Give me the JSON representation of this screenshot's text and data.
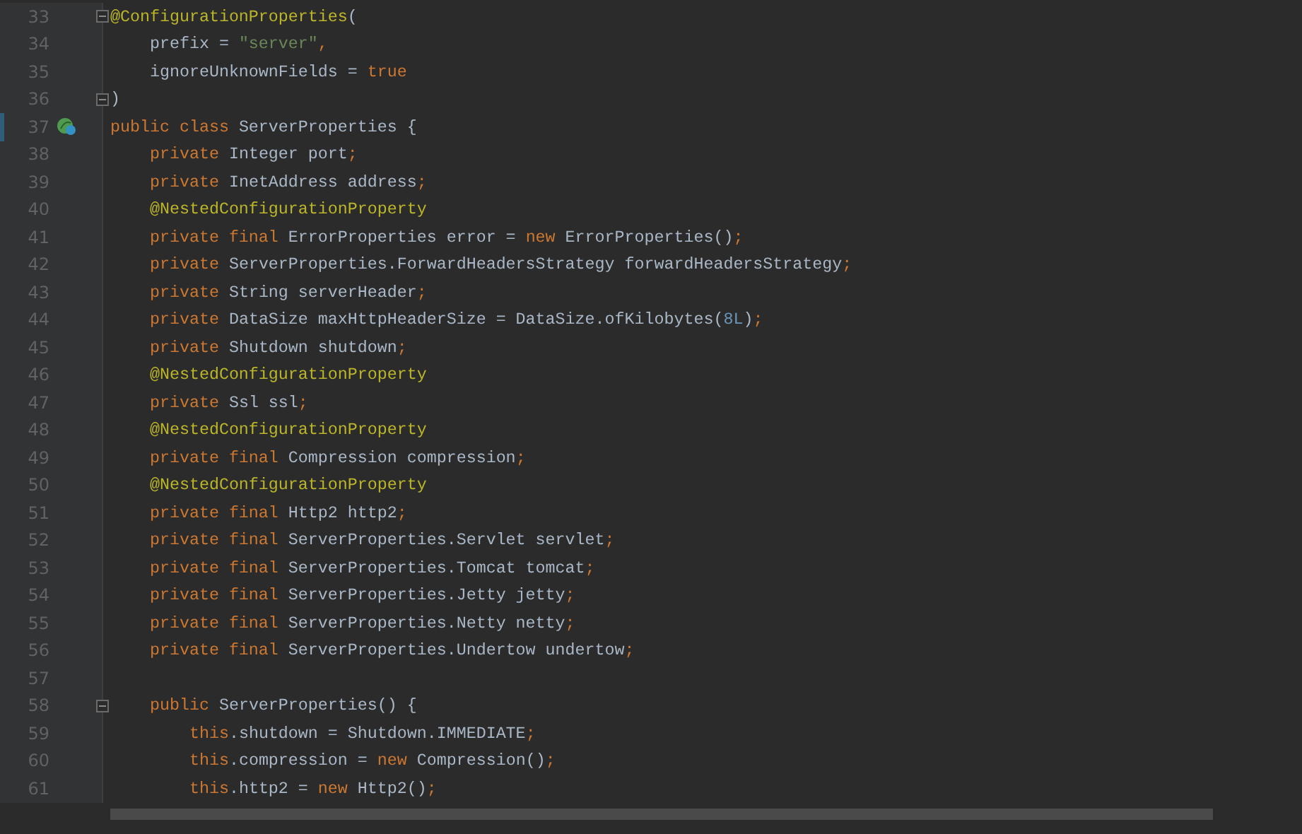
{
  "editor": {
    "lines": [
      {
        "number": "33",
        "fold": true,
        "class_icon": false,
        "changed": false,
        "tokens": [
          {
            "t": "@ConfigurationProperties",
            "color": "#bbb529"
          },
          {
            "t": "(",
            "color": "#a9b7c6"
          }
        ]
      },
      {
        "number": "34",
        "fold": false,
        "class_icon": false,
        "changed": false,
        "tokens": [
          {
            "t": "    prefix = ",
            "color": "#a9b7c6"
          },
          {
            "t": "\"server\"",
            "color": "#6a8759"
          },
          {
            "t": ",",
            "color": "#cc7832"
          }
        ]
      },
      {
        "number": "35",
        "fold": false,
        "class_icon": false,
        "changed": false,
        "tokens": [
          {
            "t": "    ignoreUnknownFields = ",
            "color": "#a9b7c6"
          },
          {
            "t": "true",
            "color": "#cc7832"
          }
        ]
      },
      {
        "number": "36",
        "fold": true,
        "class_icon": false,
        "changed": false,
        "tokens": [
          {
            "t": ")",
            "color": "#a9b7c6"
          }
        ]
      },
      {
        "number": "37",
        "fold": false,
        "class_icon": true,
        "changed": true,
        "tokens": [
          {
            "t": "public class ",
            "color": "#cc7832"
          },
          {
            "t": "ServerProperties {",
            "color": "#a9b7c6"
          }
        ]
      },
      {
        "number": "38",
        "fold": false,
        "class_icon": false,
        "changed": false,
        "tokens": [
          {
            "t": "    private ",
            "color": "#cc7832"
          },
          {
            "t": "Integer port",
            "color": "#a9b7c6"
          },
          {
            "t": ";",
            "color": "#cc7832"
          }
        ]
      },
      {
        "number": "39",
        "fold": false,
        "class_icon": false,
        "changed": false,
        "tokens": [
          {
            "t": "    private ",
            "color": "#cc7832"
          },
          {
            "t": "InetAddress address",
            "color": "#a9b7c6"
          },
          {
            "t": ";",
            "color": "#cc7832"
          }
        ]
      },
      {
        "number": "40",
        "fold": false,
        "class_icon": false,
        "changed": false,
        "tokens": [
          {
            "t": "    @NestedConfigurationProperty",
            "color": "#bbb529"
          }
        ]
      },
      {
        "number": "41",
        "fold": false,
        "class_icon": false,
        "changed": false,
        "tokens": [
          {
            "t": "    private final ",
            "color": "#cc7832"
          },
          {
            "t": "ErrorProperties error = ",
            "color": "#a9b7c6"
          },
          {
            "t": "new ",
            "color": "#cc7832"
          },
          {
            "t": "ErrorProperties()",
            "color": "#a9b7c6"
          },
          {
            "t": ";",
            "color": "#cc7832"
          }
        ]
      },
      {
        "number": "42",
        "fold": false,
        "class_icon": false,
        "changed": false,
        "tokens": [
          {
            "t": "    private ",
            "color": "#cc7832"
          },
          {
            "t": "ServerProperties.ForwardHeadersStrategy forwardHeadersStrategy",
            "color": "#a9b7c6"
          },
          {
            "t": ";",
            "color": "#cc7832"
          }
        ]
      },
      {
        "number": "43",
        "fold": false,
        "class_icon": false,
        "changed": false,
        "tokens": [
          {
            "t": "    private ",
            "color": "#cc7832"
          },
          {
            "t": "String serverHeader",
            "color": "#a9b7c6"
          },
          {
            "t": ";",
            "color": "#cc7832"
          }
        ]
      },
      {
        "number": "44",
        "fold": false,
        "class_icon": false,
        "changed": false,
        "tokens": [
          {
            "t": "    private ",
            "color": "#cc7832"
          },
          {
            "t": "DataSize maxHttpHeaderSize = DataSize.ofKilobytes(",
            "color": "#a9b7c6"
          },
          {
            "t": "8L",
            "color": "#6897bb"
          },
          {
            "t": ")",
            "color": "#a9b7c6"
          },
          {
            "t": ";",
            "color": "#cc7832"
          }
        ]
      },
      {
        "number": "45",
        "fold": false,
        "class_icon": false,
        "changed": false,
        "tokens": [
          {
            "t": "    private ",
            "color": "#cc7832"
          },
          {
            "t": "Shutdown shutdown",
            "color": "#a9b7c6"
          },
          {
            "t": ";",
            "color": "#cc7832"
          }
        ]
      },
      {
        "number": "46",
        "fold": false,
        "class_icon": false,
        "changed": false,
        "tokens": [
          {
            "t": "    @NestedConfigurationProperty",
            "color": "#bbb529"
          }
        ]
      },
      {
        "number": "47",
        "fold": false,
        "class_icon": false,
        "changed": false,
        "tokens": [
          {
            "t": "    private ",
            "color": "#cc7832"
          },
          {
            "t": "Ssl ssl",
            "color": "#a9b7c6"
          },
          {
            "t": ";",
            "color": "#cc7832"
          }
        ]
      },
      {
        "number": "48",
        "fold": false,
        "class_icon": false,
        "changed": false,
        "tokens": [
          {
            "t": "    @NestedConfigurationProperty",
            "color": "#bbb529"
          }
        ]
      },
      {
        "number": "49",
        "fold": false,
        "class_icon": false,
        "changed": false,
        "tokens": [
          {
            "t": "    private final ",
            "color": "#cc7832"
          },
          {
            "t": "Compression compression",
            "color": "#a9b7c6"
          },
          {
            "t": ";",
            "color": "#cc7832"
          }
        ]
      },
      {
        "number": "50",
        "fold": false,
        "class_icon": false,
        "changed": false,
        "tokens": [
          {
            "t": "    @NestedConfigurationProperty",
            "color": "#bbb529"
          }
        ]
      },
      {
        "number": "51",
        "fold": false,
        "class_icon": false,
        "changed": false,
        "tokens": [
          {
            "t": "    private final ",
            "color": "#cc7832"
          },
          {
            "t": "Http2 http2",
            "color": "#a9b7c6"
          },
          {
            "t": ";",
            "color": "#cc7832"
          }
        ]
      },
      {
        "number": "52",
        "fold": false,
        "class_icon": false,
        "changed": false,
        "tokens": [
          {
            "t": "    private final ",
            "color": "#cc7832"
          },
          {
            "t": "ServerProperties.Servlet servlet",
            "color": "#a9b7c6"
          },
          {
            "t": ";",
            "color": "#cc7832"
          }
        ]
      },
      {
        "number": "53",
        "fold": false,
        "class_icon": false,
        "changed": false,
        "tokens": [
          {
            "t": "    private final ",
            "color": "#cc7832"
          },
          {
            "t": "ServerProperties.Tomcat tomcat",
            "color": "#a9b7c6"
          },
          {
            "t": ";",
            "color": "#cc7832"
          }
        ]
      },
      {
        "number": "54",
        "fold": false,
        "class_icon": false,
        "changed": false,
        "tokens": [
          {
            "t": "    private final ",
            "color": "#cc7832"
          },
          {
            "t": "ServerProperties.Jetty jetty",
            "color": "#a9b7c6"
          },
          {
            "t": ";",
            "color": "#cc7832"
          }
        ]
      },
      {
        "number": "55",
        "fold": false,
        "class_icon": false,
        "changed": false,
        "tokens": [
          {
            "t": "    private final ",
            "color": "#cc7832"
          },
          {
            "t": "ServerProperties.Netty netty",
            "color": "#a9b7c6"
          },
          {
            "t": ";",
            "color": "#cc7832"
          }
        ]
      },
      {
        "number": "56",
        "fold": false,
        "class_icon": false,
        "changed": false,
        "tokens": [
          {
            "t": "    private final ",
            "color": "#cc7832"
          },
          {
            "t": "ServerProperties.Undertow undertow",
            "color": "#a9b7c6"
          },
          {
            "t": ";",
            "color": "#cc7832"
          }
        ]
      },
      {
        "number": "57",
        "fold": false,
        "class_icon": false,
        "changed": false
      },
      {
        "number": "58",
        "fold": true,
        "class_icon": false,
        "changed": false,
        "tokens": [
          {
            "t": "    public ",
            "color": "#cc7832"
          },
          {
            "t": "ServerProperties() {",
            "color": "#a9b7c6"
          }
        ]
      },
      {
        "number": "59",
        "fold": false,
        "class_icon": false,
        "changed": false,
        "tokens": [
          {
            "t": "        this",
            "color": "#cc7832"
          },
          {
            "t": ".shutdown = Shutdown.IMMEDIATE",
            "color": "#a9b7c6"
          },
          {
            "t": ";",
            "color": "#cc7832"
          }
        ]
      },
      {
        "number": "60",
        "fold": false,
        "class_icon": false,
        "changed": false,
        "tokens": [
          {
            "t": "        this",
            "color": "#cc7832"
          },
          {
            "t": ".compression = ",
            "color": "#a9b7c6"
          },
          {
            "t": "new ",
            "color": "#cc7832"
          },
          {
            "t": "Compression()",
            "color": "#a9b7c6"
          },
          {
            "t": ";",
            "color": "#cc7832"
          }
        ]
      },
      {
        "number": "61",
        "fold": false,
        "class_icon": false,
        "changed": false,
        "tokens": [
          {
            "t": "        this",
            "color": "#cc7832"
          },
          {
            "t": ".http2 = ",
            "color": "#a9b7c6"
          },
          {
            "t": "new ",
            "color": "#cc7832"
          },
          {
            "t": "Http2()",
            "color": "#a9b7c6"
          },
          {
            "t": ";",
            "color": "#cc7832"
          }
        ]
      }
    ]
  }
}
